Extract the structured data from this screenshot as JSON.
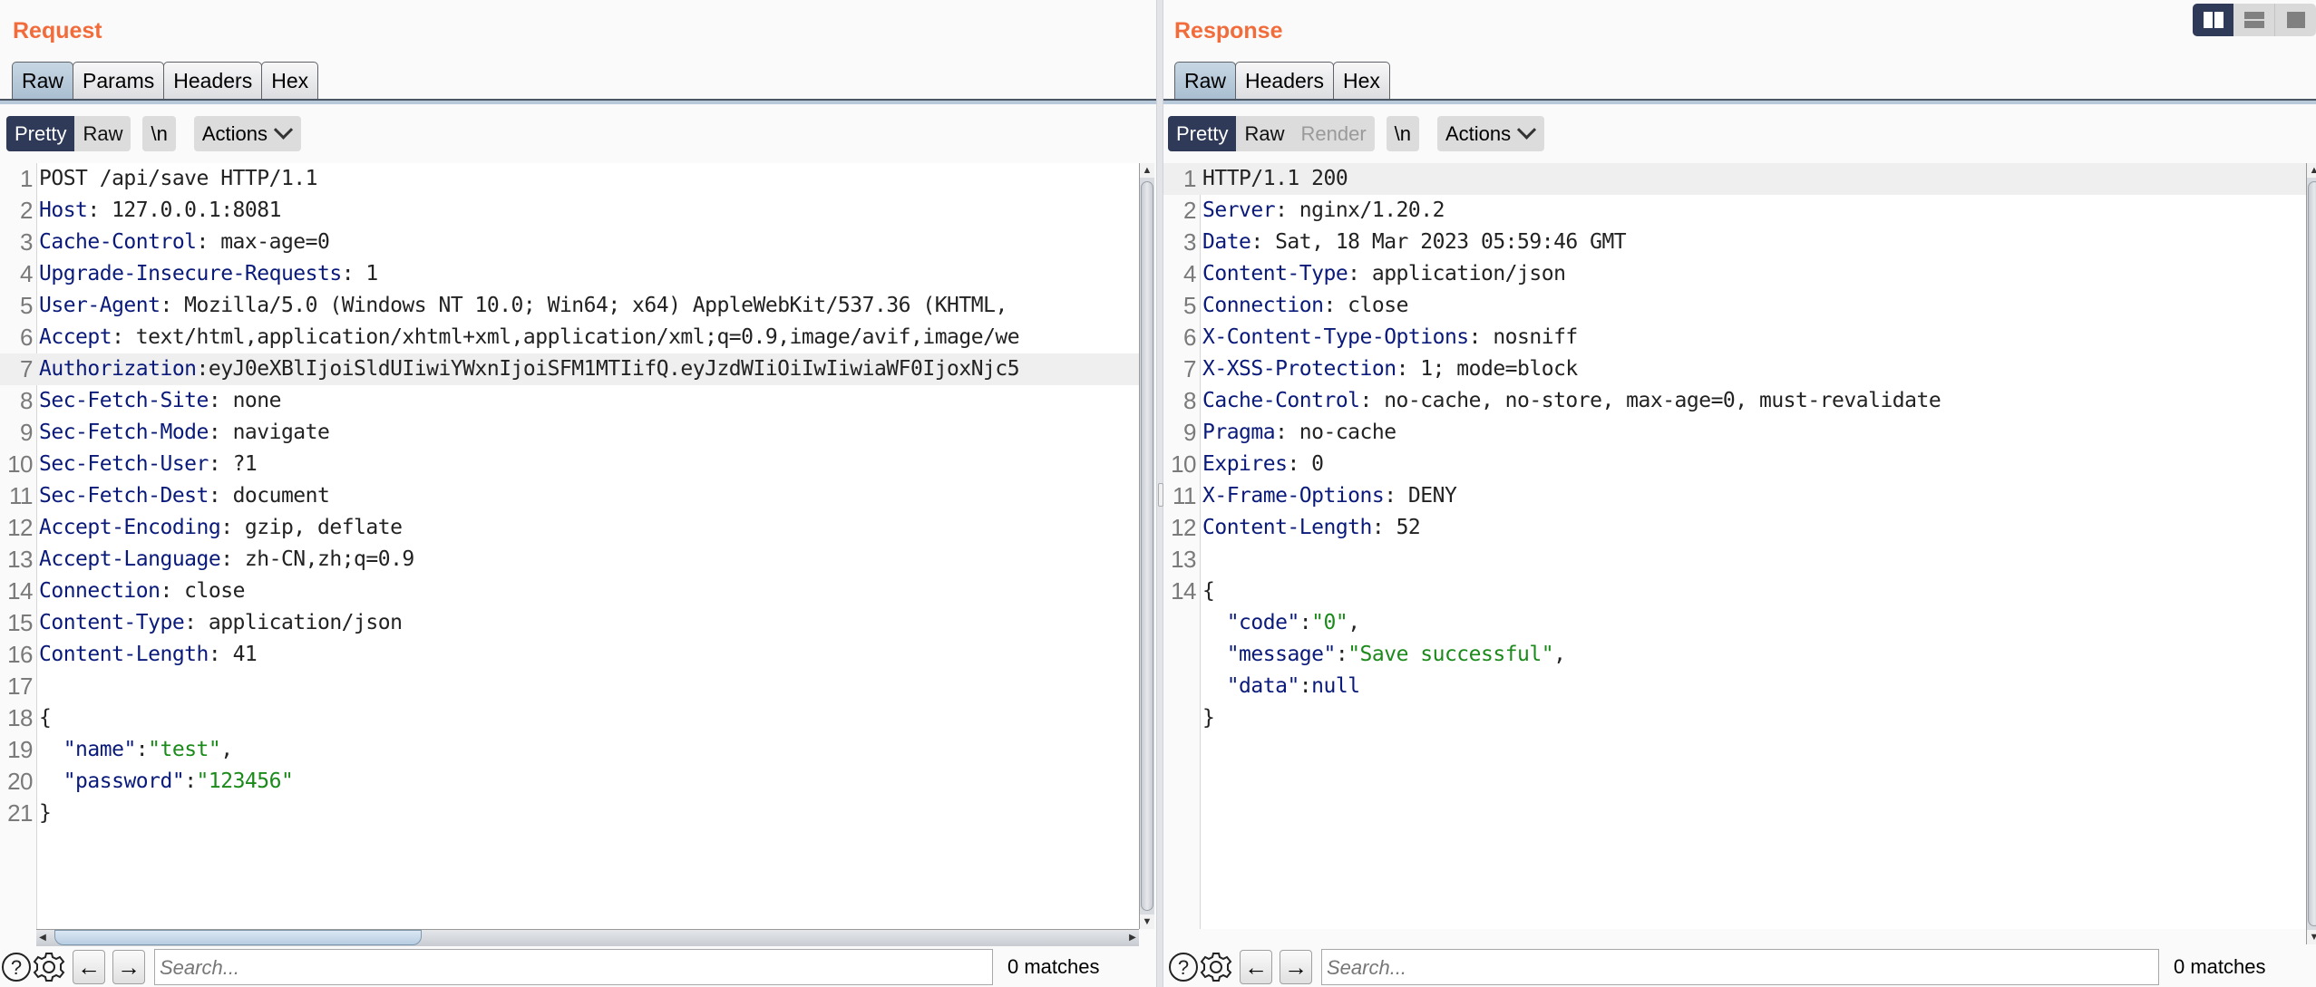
{
  "request": {
    "title": "Request",
    "tabs": [
      {
        "label": "Raw",
        "active": true
      },
      {
        "label": "Params",
        "active": false
      },
      {
        "label": "Headers",
        "active": false
      },
      {
        "label": "Hex",
        "active": false
      }
    ],
    "view_modes": [
      "Pretty",
      "Raw"
    ],
    "active_view_mode": "Pretty",
    "newline_toggle": "\\n",
    "actions_label": "Actions",
    "lines": [
      {
        "n": "1",
        "text": "POST /api/save HTTP/1.1"
      },
      {
        "n": "2",
        "key": "Host",
        "value": ": 127.0.0.1:8081"
      },
      {
        "n": "3",
        "key": "Cache-Control",
        "value": ": max-age=0"
      },
      {
        "n": "4",
        "key": "Upgrade-Insecure-Requests",
        "value": ": 1"
      },
      {
        "n": "5",
        "key": "User-Agent",
        "value": ": Mozilla/5.0 (Windows NT 10.0; Win64; x64) AppleWebKit/537.36 (KHTML,"
      },
      {
        "n": "6",
        "key": "Accept",
        "value": ": text/html,application/xhtml+xml,application/xml;q=0.9,image/avif,image/we"
      },
      {
        "n": "7",
        "key": "Authorization",
        "value": ":eyJ0eXBlIjoiSldUIiwiYWxnIjoiSFM1MTIifQ.eyJzdWIiOiIwIiwiaWF0IjoxNjc5",
        "highlight": true
      },
      {
        "n": "8",
        "key": "Sec-Fetch-Site",
        "value": ": none"
      },
      {
        "n": "9",
        "key": "Sec-Fetch-Mode",
        "value": ": navigate"
      },
      {
        "n": "10",
        "key": "Sec-Fetch-User",
        "value": ": ?1"
      },
      {
        "n": "11",
        "key": "Sec-Fetch-Dest",
        "value": ": document"
      },
      {
        "n": "12",
        "key": "Accept-Encoding",
        "value": ": gzip, deflate"
      },
      {
        "n": "13",
        "key": "Accept-Language",
        "value": ": zh-CN,zh;q=0.9"
      },
      {
        "n": "14",
        "key": "Connection",
        "value": ": close"
      },
      {
        "n": "15",
        "key": "Content-Type",
        "value": ": application/json"
      },
      {
        "n": "16",
        "key": "Content-Length",
        "value": ": 41"
      },
      {
        "n": "17",
        "text": ""
      },
      {
        "n": "18",
        "text": "{"
      },
      {
        "n": "19",
        "indent": "  ",
        "jkey": "\"name\"",
        "sep": ":",
        "jval": "\"test\"",
        "tail": ","
      },
      {
        "n": "20",
        "indent": "  ",
        "jkey": "\"password\"",
        "sep": ":",
        "jval": "\"123456\"",
        "tail": ""
      },
      {
        "n": "21",
        "text": "}"
      }
    ],
    "search_placeholder": "Search...",
    "matches": "0 matches"
  },
  "response": {
    "title": "Response",
    "tabs": [
      {
        "label": "Raw",
        "active": true
      },
      {
        "label": "Headers",
        "active": false
      },
      {
        "label": "Hex",
        "active": false
      }
    ],
    "view_modes": [
      "Pretty",
      "Raw",
      "Render"
    ],
    "active_view_mode": "Pretty",
    "disabled_view_mode": "Render",
    "newline_toggle": "\\n",
    "actions_label": "Actions",
    "lines": [
      {
        "n": "1",
        "text": "HTTP/1.1 200",
        "highlight": true
      },
      {
        "n": "2",
        "key": "Server",
        "value": ": nginx/1.20.2"
      },
      {
        "n": "3",
        "key": "Date",
        "value": ": Sat, 18 Mar 2023 05:59:46 GMT"
      },
      {
        "n": "4",
        "key": "Content-Type",
        "value": ": application/json"
      },
      {
        "n": "5",
        "key": "Connection",
        "value": ": close"
      },
      {
        "n": "6",
        "key": "X-Content-Type-Options",
        "value": ": nosniff"
      },
      {
        "n": "7",
        "key": "X-XSS-Protection",
        "value": ": 1; mode=block"
      },
      {
        "n": "8",
        "key": "Cache-Control",
        "value": ": no-cache, no-store, max-age=0, must-revalidate"
      },
      {
        "n": "9",
        "key": "Pragma",
        "value": ": no-cache"
      },
      {
        "n": "10",
        "key": "Expires",
        "value": ": 0"
      },
      {
        "n": "11",
        "key": "X-Frame-Options",
        "value": ": DENY"
      },
      {
        "n": "12",
        "key": "Content-Length",
        "value": ": 52"
      },
      {
        "n": "13",
        "text": ""
      },
      {
        "n": "14",
        "text": "{"
      },
      {
        "n": "",
        "indent": "  ",
        "jkey": "\"code\"",
        "sep": ":",
        "jval": "\"0\"",
        "tail": ","
      },
      {
        "n": "",
        "indent": "  ",
        "jkey": "\"message\"",
        "sep": ":",
        "jval": "\"Save successful\"",
        "tail": ","
      },
      {
        "n": "",
        "indent": "  ",
        "jkey": "\"data\"",
        "sep": ":",
        "jraw": "null",
        "tail": ""
      },
      {
        "n": "",
        "text": "}"
      }
    ],
    "search_placeholder": "Search...",
    "matches": "0 matches"
  },
  "layout_toggle": {
    "options": [
      "side-by-side",
      "stacked",
      "single"
    ],
    "active": "side-by-side"
  },
  "colors": {
    "title_accent": "#f26b3a",
    "header_key": "#0a1a7a",
    "json_string": "#1a8a1a",
    "active_button": "#2e3a57"
  }
}
